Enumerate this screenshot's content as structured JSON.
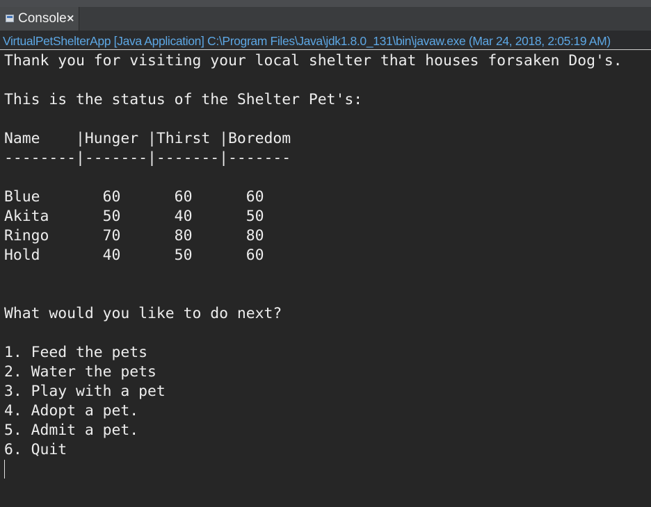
{
  "tab": {
    "label": "Console",
    "close_glyph": "×",
    "icon": "console-icon"
  },
  "launch_info": "VirtualPetShelterApp [Java Application] C:\\Program Files\\Java\\jdk1.8.0_131\\bin\\javaw.exe (Mar 24, 2018, 2:05:19 AM)",
  "console_output": {
    "greeting": "Thank you for visiting your local shelter that houses forsaken Dog's.",
    "status_heading": "This is the status of the Shelter Pet's:",
    "table_header": "Name    |Hunger |Thirst |Boredom",
    "table_separator": "--------|-------|-------|-------",
    "pets": [
      {
        "row": "Blue       60      60      60"
      },
      {
        "row": "Akita      50      40      50"
      },
      {
        "row": "Ringo      70      80      80"
      },
      {
        "row": "Hold       40      50      60"
      }
    ],
    "prompt": "What would you like to do next?",
    "menu": [
      "1. Feed the pets",
      "2. Water the pets",
      "3. Play with a pet",
      "4. Adopt a pet.",
      "5. Admit a pet.",
      "6. Quit"
    ]
  }
}
